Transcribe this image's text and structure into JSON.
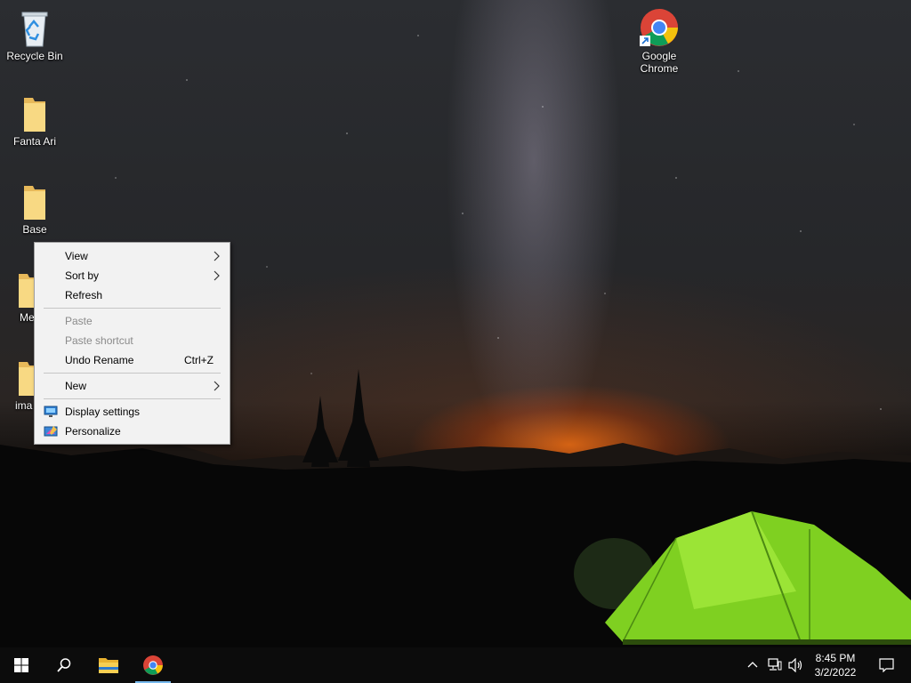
{
  "desktop": {
    "icons": [
      {
        "label": "Recycle Bin"
      },
      {
        "label": "Fanta Ari"
      },
      {
        "label": "Base"
      },
      {
        "label": "Me"
      },
      {
        "label": "ima"
      },
      {
        "label": "Google Chrome"
      }
    ]
  },
  "context_menu": {
    "items": [
      {
        "label": "View",
        "submenu": true
      },
      {
        "label": "Sort by",
        "submenu": true
      },
      {
        "label": "Refresh"
      },
      {
        "label": "Paste",
        "disabled": true
      },
      {
        "label": "Paste shortcut",
        "disabled": true
      },
      {
        "label": "Undo Rename",
        "shortcut": "Ctrl+Z"
      },
      {
        "label": "New",
        "submenu": true
      },
      {
        "label": "Display settings",
        "icon": "display-icon"
      },
      {
        "label": "Personalize",
        "icon": "personalize-icon"
      }
    ]
  },
  "taskbar": {
    "time": "8:45 PM",
    "date": "3/2/2022",
    "pinned": [
      "start-icon",
      "search-icon",
      "file-explorer-icon",
      "chrome-icon"
    ],
    "tray_icons": [
      "chevron-up-icon",
      "network-icon",
      "volume-icon",
      "notification-icon"
    ],
    "accent_color": "#76b9ed"
  }
}
